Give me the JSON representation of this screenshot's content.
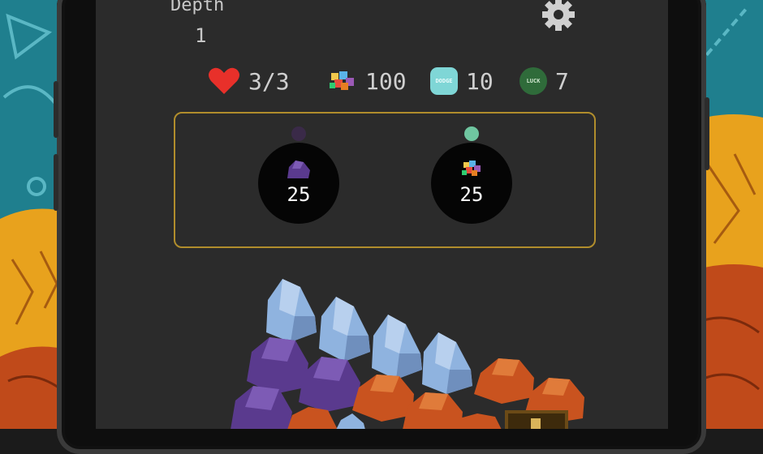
{
  "header": {
    "depth_label": "Depth",
    "depth_value": "1"
  },
  "stats": {
    "health": "3/3",
    "gems": "100",
    "dodge_value": "10",
    "dodge_badge_text": "DODGE",
    "luck_value": "7",
    "luck_badge_text": "LUCK"
  },
  "shop": {
    "offers": [
      {
        "item": "purple-ore",
        "price": "25",
        "indicator_color": "#3a2a48"
      },
      {
        "item": "gems",
        "price": "25",
        "indicator_color": "#6fc6a0"
      }
    ]
  },
  "colors": {
    "heart": "#e8302a",
    "dodge_badge": "#7fd6d6",
    "luck_badge": "#2f6b3a",
    "offer_border": "#b08d2c",
    "blue_rock": "#8fb3df",
    "purple_rock": "#5a3a8e",
    "orange_rock": "#c9531f"
  },
  "icons": {
    "settings": "gear-icon",
    "health": "heart-icon",
    "gems": "gems-icon"
  }
}
